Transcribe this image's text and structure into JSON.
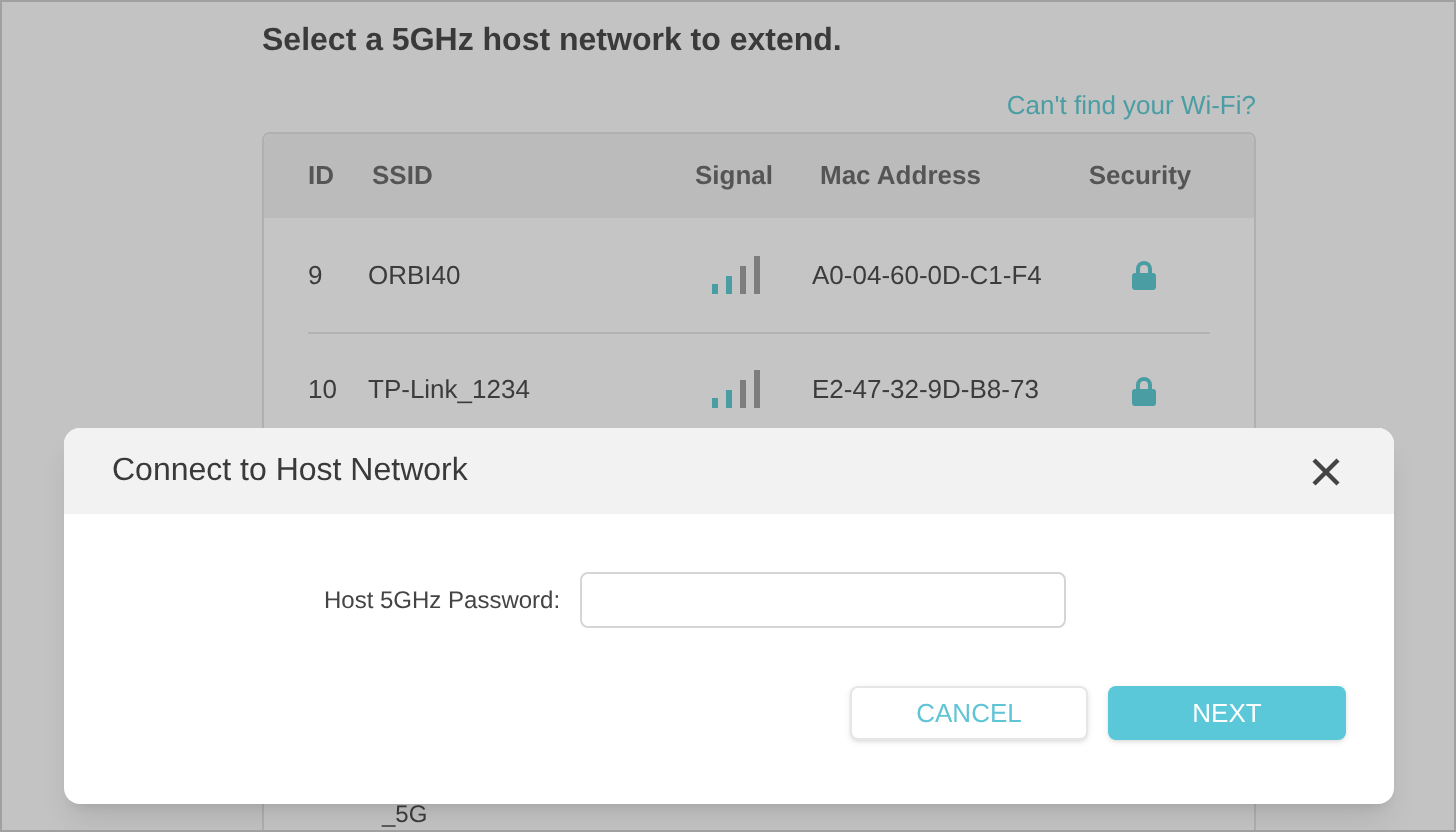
{
  "page": {
    "title": "Select a 5GHz host network to extend.",
    "help_link": "Can't find your Wi-Fi?"
  },
  "table": {
    "columns": [
      "ID",
      "SSID",
      "Signal",
      "Mac Address",
      "Security"
    ],
    "rows": [
      {
        "id": "9",
        "ssid": "ORBI40",
        "mac": "A0-04-60-0D-C1-F4",
        "secured": true
      },
      {
        "id": "10",
        "ssid": "TP-Link_1234",
        "mac": "E2-47-32-9D-B8-73",
        "secured": true
      }
    ],
    "partial_row": {
      "ssid": "_5G"
    }
  },
  "dialog": {
    "title": "Connect to Host Network",
    "field_label": "Host 5GHz Password:",
    "buttons": [
      "CANCEL",
      "NEXT"
    ]
  }
}
